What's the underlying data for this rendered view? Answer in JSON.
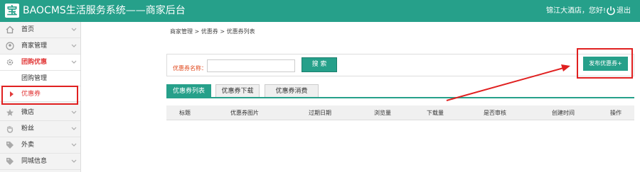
{
  "header": {
    "logo_char": "宝",
    "title": "BAOCMS生活服务系统——商家后台",
    "greeting": "锦江大酒店，您好!",
    "logout_label": "退出"
  },
  "sidebar": {
    "items": [
      {
        "label": "首页",
        "icon": "home-icon"
      },
      {
        "label": "商家管理",
        "icon": "user-icon"
      },
      {
        "label": "团购优惠",
        "icon": "gear-icon"
      },
      {
        "label": "团购管理"
      },
      {
        "label": "优惠券"
      },
      {
        "label": "微店",
        "icon": "star-icon"
      },
      {
        "label": "粉丝",
        "icon": "hand-icon"
      },
      {
        "label": "外卖",
        "icon": "tag-icon"
      },
      {
        "label": "同城信息",
        "icon": "tag-icon"
      }
    ]
  },
  "breadcrumb": "商家管理 > 优惠券 > 优惠券列表",
  "search": {
    "label": "优惠券名称：",
    "value": "",
    "button_label": "搜 索"
  },
  "publish_label": "发布优惠券+",
  "tabs": [
    "优惠券列表",
    "优惠券下载",
    "优惠券消费"
  ],
  "table": {
    "columns": [
      "标题",
      "优惠券图片",
      "过期日期",
      "浏览量",
      "下载量",
      "是否审核",
      "创建时间",
      "操作"
    ]
  },
  "colors": {
    "brand": "#26a08a",
    "annotation": "#e02020"
  }
}
